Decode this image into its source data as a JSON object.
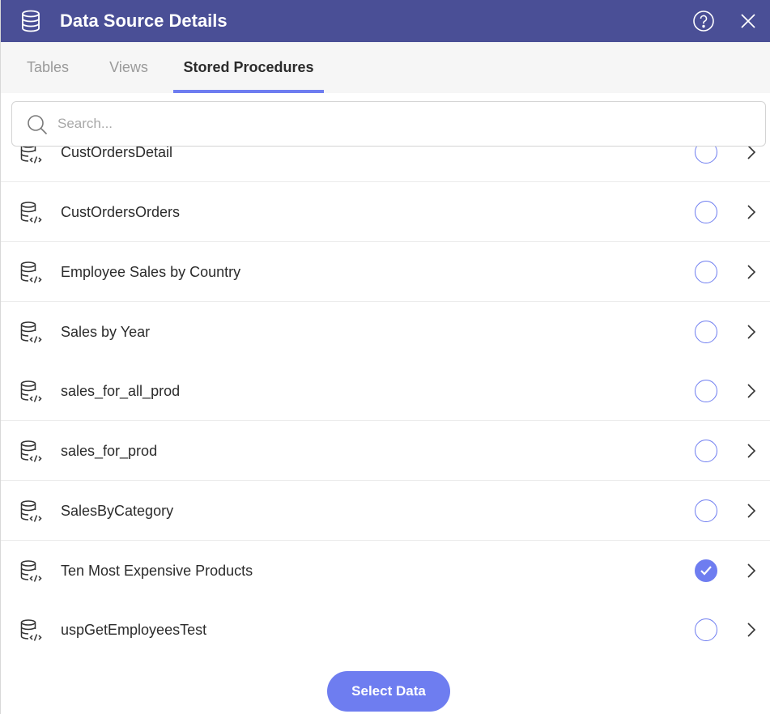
{
  "header": {
    "title": "Data Source Details",
    "icons": {
      "source": "database-icon",
      "help": "help-circle-icon",
      "close": "close-icon"
    },
    "background": "#4a4f96"
  },
  "tabs": [
    {
      "label": "Tables",
      "active": false
    },
    {
      "label": "Views",
      "active": false
    },
    {
      "label": "Stored Procedures",
      "active": true
    }
  ],
  "search": {
    "placeholder": "Search...",
    "value": ""
  },
  "procedures": [
    {
      "label": "CustOrdersDetail",
      "selected": false
    },
    {
      "label": "CustOrdersOrders",
      "selected": false
    },
    {
      "label": "Employee Sales by Country",
      "selected": false
    },
    {
      "label": "Sales by Year",
      "selected": false
    },
    {
      "label": "sales_for_all_prod",
      "selected": false
    },
    {
      "label": "sales_for_prod",
      "selected": false
    },
    {
      "label": "SalesByCategory",
      "selected": false
    },
    {
      "label": "Ten Most Expensive Products",
      "selected": true
    },
    {
      "label": "uspGetEmployeesTest",
      "selected": false
    }
  ],
  "footer": {
    "select_label": "Select Data"
  },
  "colors": {
    "accent": "#6e7df0",
    "header": "#4a4f96",
    "divider": "#ececec"
  }
}
